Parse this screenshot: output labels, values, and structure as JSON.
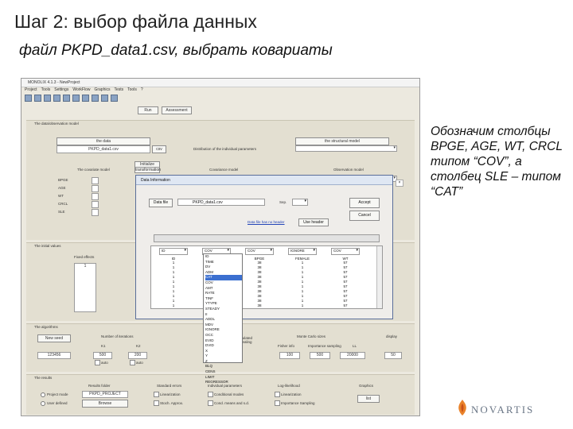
{
  "slide": {
    "title": "Шаг 2: выбор файла данных",
    "subtitle": "файл PKPD_data1.csv, выбрать ковариаты",
    "note": "Обозначим столбцы BPGE, AGE, WT, CRCL типом “COV”, а столбец SLE – типом “CAT”",
    "logo_text": "NOVARTIS"
  },
  "app": {
    "title": "MONOLIX 4.1.3 - NewProject",
    "menu": [
      "Project",
      "Tools",
      "Settings",
      "WorkFlow",
      "Graphics",
      "Tests",
      "Tools",
      "?"
    ],
    "run_label": "Run",
    "assessment_label": "Assessment",
    "data_panel": {
      "header": "The data/observation model",
      "file_button": "the data",
      "file_value": "PKPD_data1.csv",
      "file_browse": "csv",
      "model_button": "the structural model",
      "distribution_label": "Distribution of the individual parameters",
      "covariate_label": "The covariate model",
      "initialize_button": "Initialize",
      "transform_button": "transformation",
      "variance_label": "Covariance model",
      "observation_label": "Observation model",
      "covariates": [
        "BPGE",
        "AGE",
        "WT",
        "CRCL",
        "SLE"
      ]
    },
    "initial_panel": {
      "header": "The initial values",
      "fixed_effects": "Fixed effects"
    },
    "algo_panel": {
      "header": "The algorithms",
      "new_seed": "New seed",
      "seed": "123456",
      "chains_label": "Number of iterations",
      "k1": "K1",
      "k2": "K2",
      "k1_val": "500",
      "k2_val": "200",
      "auto1": "auto",
      "auto2": "auto",
      "simulated_annealing": "Simulated annealing",
      "mc_label": "Monte Carlo sizes",
      "fim": "Fisher info",
      "is": "Importance sampling",
      "ll": "LL",
      "mc_vals": [
        "100",
        "500",
        "20000"
      ],
      "display": "display",
      "display_val": "50"
    },
    "results_panel": {
      "header": "The results",
      "results_folder": "Results folder",
      "folder_value": "PKPD_PROJECT",
      "browse": "Browse",
      "project_mode": "Project mode",
      "user_defined": "User defined",
      "std_errors": "Standard errors",
      "linearization": "Linearization",
      "stoch_approx": "Stoch. Approx.",
      "indiv_params": "Individual parameters",
      "cond_modes": "Conditional modes",
      "cond_means": "Cond. means and s.d.",
      "loglik": "Log-likelihood",
      "linearization2": "Linearization",
      "imp_sampling": "Importance Sampling",
      "graphics": "Graphics",
      "list_button": "list"
    }
  },
  "dialog": {
    "title": "Data Information",
    "data_file_button": "Data file",
    "filename": "PKPD_data1.csv",
    "sep_label": "Sep.",
    "accept_button": "Accept",
    "cancel_button": "Cancel",
    "no_header_link": "Data file has no header",
    "use_header_button": "Use header",
    "columns": [
      {
        "type": "ID",
        "name": "ID",
        "values": [
          "1",
          "1",
          "1",
          "1",
          "1",
          "1",
          "1",
          "1",
          "1",
          "1"
        ]
      },
      {
        "type": "COV",
        "name": "AGE",
        "values": [
          "0",
          "0",
          "0",
          "0",
          "0",
          "0",
          "0",
          "0",
          "0",
          "0"
        ]
      },
      {
        "type": "COV",
        "name": "BPGE",
        "values": [
          "38",
          "38",
          "38",
          "38",
          "38",
          "38",
          "38",
          "38",
          "38",
          "38"
        ]
      },
      {
        "type": "IGNORE",
        "name": "FEMALE",
        "values": [
          "1",
          "1",
          "1",
          "1",
          "1",
          "1",
          "1",
          "1",
          "1",
          "1"
        ]
      },
      {
        "type": "COV",
        "name": "WT",
        "values": [
          "57",
          "57",
          "57",
          "57",
          "57",
          "57",
          "57",
          "57",
          "57",
          "57"
        ]
      }
    ],
    "type_options": [
      "ID",
      "TIME",
      "DV",
      "ADM",
      "CAT",
      "COV",
      "AMT",
      "RATE",
      "TINF",
      "YTYPE",
      "STEADY",
      "II",
      "ADDL",
      "MDV",
      "IGNORE",
      "OCC",
      "EVID",
      "DVID",
      "X",
      "Y",
      "Z",
      "BLQ",
      "CENS",
      "LIMIT",
      "REGRESSOR"
    ]
  },
  "colors": {
    "window_bg": "#ece9df",
    "panel_bg": "#e3dfd1",
    "dialog_bg": "#efedea",
    "selection": "#3b6fd0"
  }
}
